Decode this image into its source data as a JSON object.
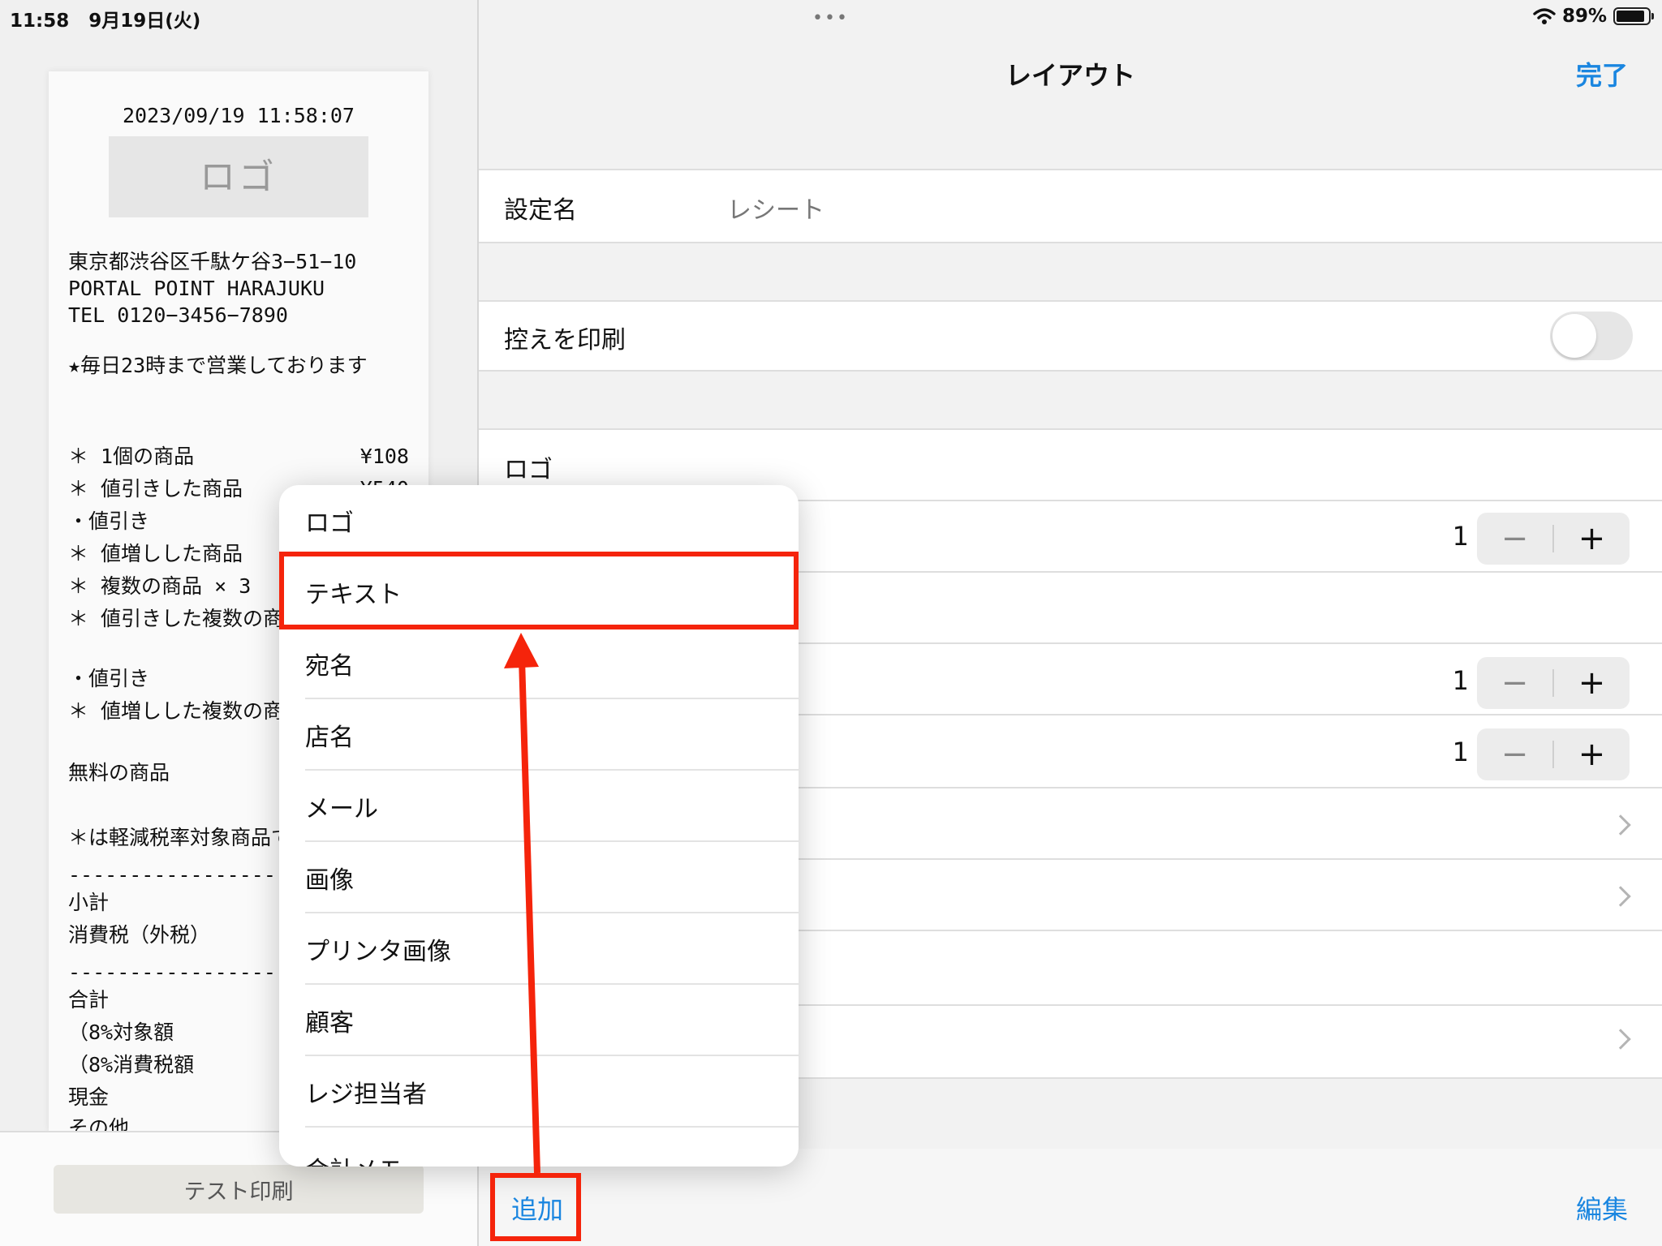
{
  "status_bar": {
    "time": "11:58",
    "date": "9月19日(火)",
    "dots": "•••",
    "battery": "89%",
    "battery_level": 0.89
  },
  "receipt": {
    "date": "2023/09/19 11:58:07",
    "logo": "ロゴ",
    "lines": [
      "東京都渋谷区千駄ケ谷3−51−10",
      "PORTAL POINT HARAJUKU",
      "TEL 0120−3456−7890",
      "★毎日23時まで営業しております",
      "＊ 1個の商品",
      "＊ 値引きした商品",
      "・値引き",
      "＊ 値増しした商品",
      "＊ 複数の商品 × 3",
      "＊ 値引きした複数の商",
      "・値引き",
      "＊ 値増しした複数の商",
      "無料の商品",
      "＊は軽減税率対象商品で",
      "-------------------------",
      "小計",
      "消費税（外税）",
      "-------------------------",
      "合計",
      "（8%対象額",
      "（8%消費税額",
      "現金",
      "その他"
    ],
    "prices": [
      "¥108",
      "¥540"
    ]
  },
  "test_print_label": "テスト印刷",
  "nav": {
    "title": "レイアウト",
    "done": "完了"
  },
  "settings": {
    "name_label": "設定名",
    "name_value": "レシート",
    "copy_label": "控えを印刷",
    "copy_on": false,
    "section_label": "ロゴ",
    "stepper_rows": [
      {
        "qty": "1",
        "minus": "−",
        "plus": "+"
      },
      {
        "qty": "1",
        "minus": "−",
        "plus": "+"
      },
      {
        "qty": "1",
        "minus": "−",
        "plus": "+"
      }
    ]
  },
  "popover": {
    "items": [
      "ロゴ",
      "テキスト",
      "宛名",
      "店名",
      "メール",
      "画像",
      "プリンタ画像",
      "顧客",
      "レジ担当者",
      "会計メモ"
    ]
  },
  "toolbar": {
    "add": "追加",
    "edit": "編集"
  },
  "colors": {
    "accent": "#1a86e0",
    "highlight": "#f5240b"
  },
  "icons": [
    "wifi-icon",
    "battery-icon",
    "chevron-right-icon",
    "minus-icon",
    "plus-icon"
  ]
}
